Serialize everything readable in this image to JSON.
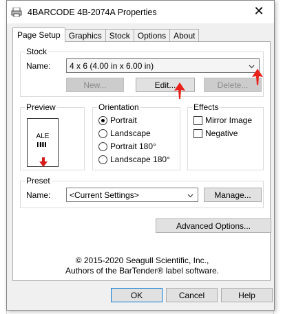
{
  "window": {
    "title": "4BARCODE 4B-2074A Properties",
    "close_label": "✕"
  },
  "tabs": [
    {
      "label": "Page Setup",
      "active": true
    },
    {
      "label": "Graphics"
    },
    {
      "label": "Stock"
    },
    {
      "label": "Options"
    },
    {
      "label": "About"
    }
  ],
  "stock": {
    "group_label": "Stock",
    "name_label": "Name:",
    "name_value": "4 x 6 (4.00 in x 6.00 in)",
    "new_label": "New...",
    "edit_label": "Edit...",
    "delete_label": "Delete..."
  },
  "preview": {
    "group_label": "Preview",
    "sample_text": "ALE"
  },
  "orientation": {
    "group_label": "Orientation",
    "options": [
      "Portrait",
      "Landscape",
      "Portrait 180°",
      "Landscape 180°"
    ],
    "selected": "Portrait"
  },
  "effects": {
    "group_label": "Effects",
    "options": [
      "Mirror Image",
      "Negative"
    ]
  },
  "preset": {
    "group_label": "Preset",
    "name_label": "Name:",
    "name_value": "<Current Settings>",
    "manage_label": "Manage..."
  },
  "advanced_label": "Advanced Options...",
  "footer": {
    "copyright": "© 2015-2020 Seagull Scientific, Inc.,",
    "authors": "Authors of the BarTender® label software."
  },
  "buttons": {
    "ok": "OK",
    "cancel": "Cancel",
    "help": "Help"
  },
  "colors": {
    "accent": "#0078d7",
    "annotation_red": "#e8211b"
  }
}
